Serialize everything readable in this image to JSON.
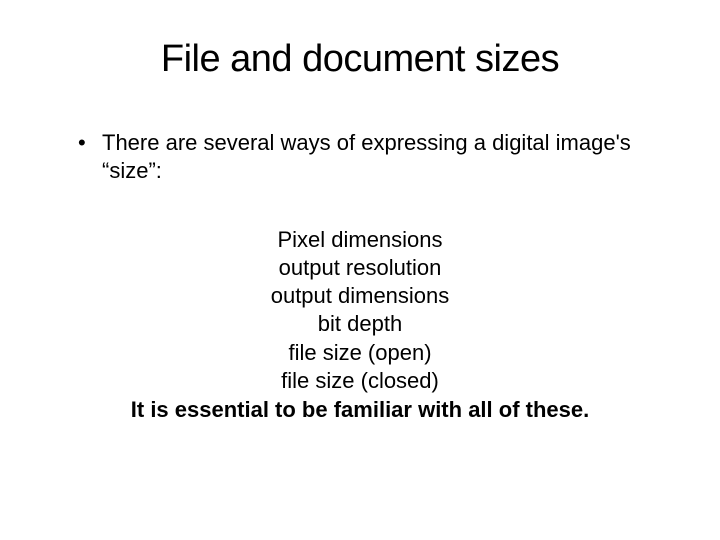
{
  "title": "File and document sizes",
  "bullet": {
    "marker": "•",
    "text": "There are several ways of expressing a digital image's “size”:"
  },
  "list": {
    "item0": "Pixel dimensions",
    "item1": "output resolution",
    "item2": "output dimensions",
    "item3": "bit depth",
    "item4": "file size (open)",
    "item5": "file size (closed)"
  },
  "conclusion": "It is essential to be familiar with all of these."
}
